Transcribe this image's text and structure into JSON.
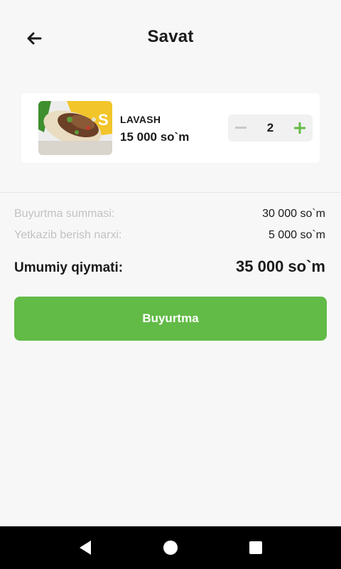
{
  "header": {
    "title": "Savat",
    "back_icon": "arrow-left-icon"
  },
  "cart": {
    "items": [
      {
        "name": "LAVASH",
        "price": "15 000 so`m",
        "quantity": "2",
        "image": "lavash-wrap-photo"
      }
    ]
  },
  "summary": {
    "order_sum_label": "Buyurtma summasi:",
    "order_sum_value": "30 000 so`m",
    "delivery_label": "Yetkazib berish narxi:",
    "delivery_value": "5 000 so`m",
    "total_label": "Umumiy qiymati:",
    "total_value": "35 000 so`m"
  },
  "order_button": {
    "label": "Buyurtma"
  },
  "colors": {
    "accent": "#62bb47",
    "background": "#f7f7f7",
    "muted_text": "#c2c2c2",
    "text": "#1a1a1a"
  },
  "navbar": {
    "back": "nav-back-icon",
    "home": "nav-home-icon",
    "recents": "nav-recents-icon"
  }
}
